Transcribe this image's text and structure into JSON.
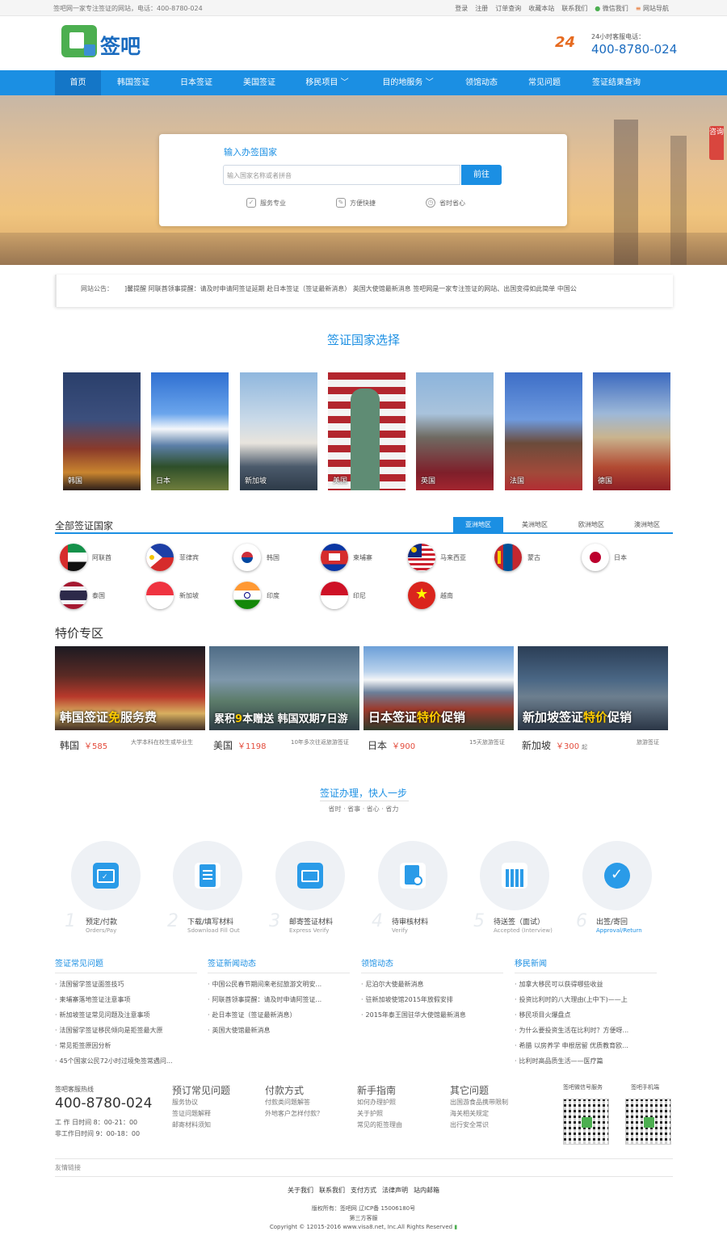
{
  "topbar": {
    "slogan": "签吧网一家专注签证的网站，电话：400-8780-024",
    "links": [
      "登录",
      "注册",
      "订单查询",
      "收藏本站",
      "联系我们",
      "微信我们",
      "网站导航"
    ]
  },
  "header": {
    "logo_text": "签吧",
    "hotline_badge": "24",
    "hotline_label": "24小时客服电话：",
    "hotline_number": "400-8780-024"
  },
  "nav": {
    "items": [
      "首页",
      "韩国签证",
      "日本签证",
      "美国签证",
      "移民项目",
      "目的地服务",
      "领馆动态",
      "常见问题",
      "签证结果查询"
    ]
  },
  "search": {
    "title": "输入办签国家",
    "placeholder": "输入国家名称或者拼音",
    "button": "前往",
    "features": [
      "服务专业",
      "方便快捷",
      "省时省心"
    ]
  },
  "side_consult": "咨询",
  "notice": {
    "label": "网站公告：",
    "text": "]馨提醒  阿联酋领事提醒：请及时申请阿签证延期  赴日本签证（签证最新消息）  英国大使馆最新消息  签吧网是一家专注签证的网站、出国变得如此简单  中国公"
  },
  "countries_section": {
    "title": "签证国家选择",
    "tiles": [
      "韩国",
      "日本",
      "新加坡",
      "美国",
      "英国",
      "法国",
      "德国"
    ]
  },
  "all_countries": {
    "title": "全部签证国家",
    "tabs": [
      "亚洲地区",
      "美洲地区",
      "欧洲地区",
      "澳洲地区"
    ],
    "flags": [
      "阿联酋",
      "菲律宾",
      "韩国",
      "柬埔寨",
      "马来西亚",
      "蒙古",
      "日本",
      "泰国",
      "新加坡",
      "印度",
      "印尼",
      "越南"
    ]
  },
  "specials": {
    "title": "特价专区",
    "items": [
      {
        "cap1": "韩国签证",
        "cap2": "免",
        "cap3": "服务费",
        "name": "韩国",
        "price": "￥585",
        "desc": "大学本科在校生或毕业生"
      },
      {
        "cap1": "累积",
        "cap2": "9",
        "cap3": "本赠送 韩国双期7日游",
        "name": "美国",
        "price": "￥1198",
        "desc": "10年多次往返旅游签证"
      },
      {
        "cap1": "日本签证",
        "cap2": "特价",
        "cap3": "促销",
        "name": "日本",
        "price": "￥900",
        "desc": "15天旅游签证"
      },
      {
        "cap1": "新加坡签证",
        "cap2": "特价",
        "cap3": "促销",
        "name": "新加坡",
        "price": "￥300",
        "price_suffix": "起",
        "desc": "旅游签证"
      }
    ]
  },
  "steps": {
    "title": "签证办理，快人一步",
    "subtitle": "省时 · 省事 · 省心 · 省力",
    "items": [
      {
        "n": "1",
        "t": "预定/付款",
        "e": "Orders/Pay"
      },
      {
        "n": "2",
        "t": "下载/填写材料",
        "e": "Sdownload Fill Out"
      },
      {
        "n": "3",
        "t": "邮寄签证材料",
        "e": "Express Verify"
      },
      {
        "n": "4",
        "t": "待审核材料",
        "e": "Verify"
      },
      {
        "n": "5",
        "t": "待送签（面试）",
        "e": "Accepted (Interview)"
      },
      {
        "n": "6",
        "t": "出签/寄回",
        "e": "Approval/Return"
      }
    ]
  },
  "news": [
    {
      "title": "签证常见问题",
      "items": [
        "法国留学签证面签技巧",
        "柬埔寨落地签证注意事项",
        "新加坡签证常见问题及注意事项",
        "法国留学签证移民倾向是拒签最大原",
        "常见拒签原因分析",
        "45个国家公民72小时过境免签常遇问..."
      ]
    },
    {
      "title": "签证新闻动态",
      "items": [
        "中国公民春节期间来老挝旅游文明安...",
        "阿联酋领事提醒：请及时申请阿签证...",
        "赴日本签证（签证最新消息）",
        "英国大使馆最新消息"
      ]
    },
    {
      "title": "领馆动态",
      "items": [
        "尼泊尔大使最新消息",
        "驻新加坡使馆2015年放假安排",
        "2015年泰王国驻华大使馆最新消息"
      ]
    },
    {
      "title": "移民新闻",
      "items": [
        "加拿大移民可以获得哪些收益",
        "投资比利时的八大理由(上中下)——上",
        "移民项目火爆盘点",
        "为什么要投资生活在比利时？方便呀...",
        "希腊 以房养学 申根居留 优质教育欧...",
        "比利时高品质生活——医疗篇"
      ]
    }
  ],
  "footer": {
    "hotline_label": "签吧客服热线",
    "hotline": "400-8780-024",
    "hours1": "工 作 日时间 8：00-21：00",
    "hours2": "非工作日时间 9：00-18：00",
    "cols": [
      {
        "h": "预订常见问题",
        "items": [
          "服务协议",
          "签证问题解释",
          "邮寄材料须知"
        ]
      },
      {
        "h": "付款方式",
        "items": [
          "付款类问题解答",
          "外地客户怎样付款？"
        ]
      },
      {
        "h": "新手指南",
        "items": [
          "如何办理护照",
          "关于护照",
          "常见的拒签理由"
        ]
      },
      {
        "h": "其它问题",
        "items": [
          "出国游食品携带限制",
          "海关相关规定",
          "出行安全常识"
        ]
      }
    ],
    "qr1": "签吧微信号服务",
    "qr2": "签吧手机端",
    "friend_links": "友情链接",
    "bottom_links": [
      "关于我们",
      "联系我们",
      "支付方式",
      "法律声明",
      "站内邮箱"
    ],
    "copy1": "版权所有：签吧网  辽ICP备 15006180号",
    "copy2": "第三方客服",
    "copy3": "Copyright © 12015-2016 www.visa8.net, Inc.All Rights Reserved"
  }
}
